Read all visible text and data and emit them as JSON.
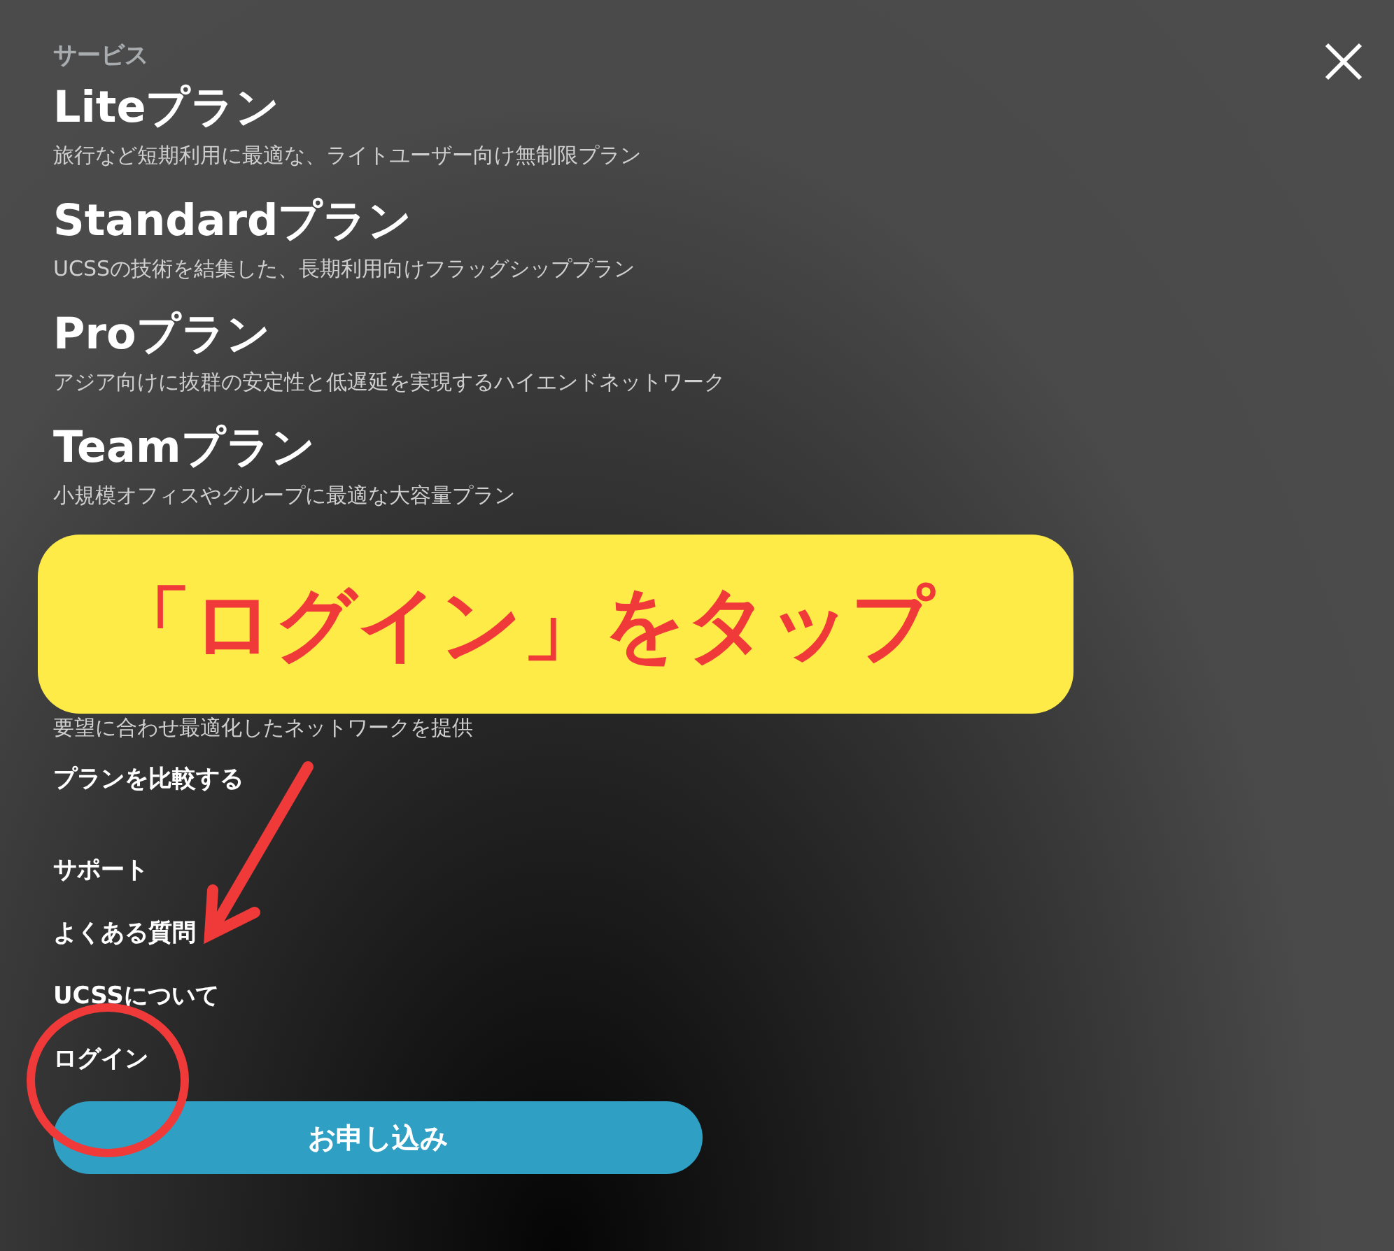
{
  "menu": {
    "section_label": "サービス",
    "plans": [
      {
        "title": "Liteプラン",
        "description": "旅行など短期利用に最適な、ライトユーザー向け無制限プラン"
      },
      {
        "title": "Standardプラン",
        "description": "UCSSの技術を結集した、長期利用向けフラッグシッププラン"
      },
      {
        "title": "Proプラン",
        "description": "アジア向けに抜群の安定性と低遅延を実現するハイエンドネットワーク"
      },
      {
        "title": "Teamプラン",
        "description": "小規模オフィスやグループに最適な大容量プラン"
      },
      {
        "description": "要望に合わせ最適化したネットワークを提供"
      }
    ],
    "compare_link": "プランを比較する",
    "links": [
      "サポート",
      "よくある質問",
      "UCSSについて",
      "ログイン"
    ],
    "apply_button": "お申し込み"
  },
  "annotation": {
    "callout": "「ログイン」をタップ"
  }
}
